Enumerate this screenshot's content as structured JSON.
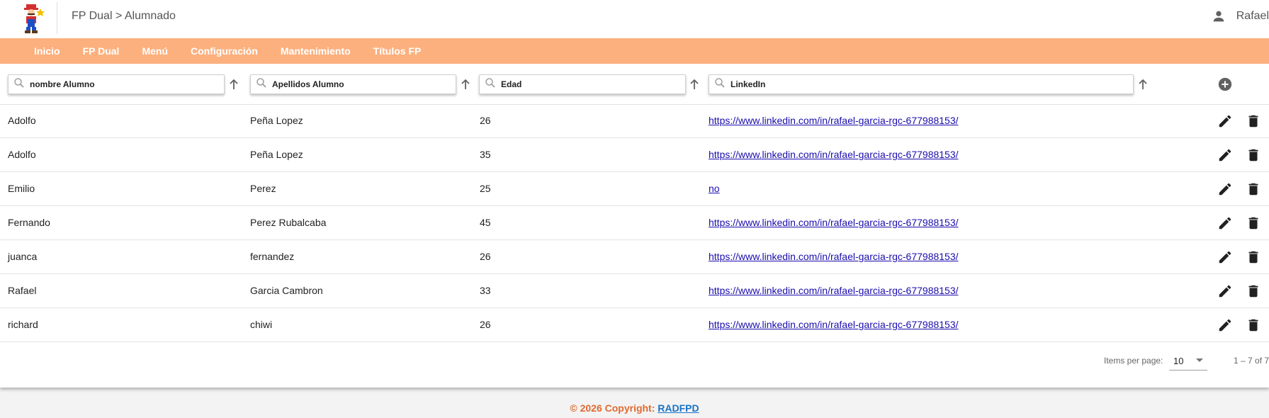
{
  "header": {
    "breadcrumb": "FP Dual > Alumnado",
    "user_name": "Rafael"
  },
  "nav": {
    "items": [
      "Inicio",
      "FP Dual",
      "Menú",
      "Configuración",
      "Mantenimiento",
      "Títulos FP"
    ]
  },
  "filters": {
    "nombre": "nombre Alumno",
    "apellidos": "Apellidos Alumno",
    "edad": "Edad",
    "linkedin": "LinkedIn"
  },
  "table": {
    "rows": [
      {
        "nombre": "Adolfo",
        "apellidos": "Peña Lopez",
        "edad": "26",
        "linkedin": "https://www.linkedin.com/in/rafael-garcia-rgc-677988153/"
      },
      {
        "nombre": "Adolfo",
        "apellidos": "Peña Lopez",
        "edad": "35",
        "linkedin": "https://www.linkedin.com/in/rafael-garcia-rgc-677988153/"
      },
      {
        "nombre": "Emilio",
        "apellidos": "Perez",
        "edad": "25",
        "linkedin": "no"
      },
      {
        "nombre": "Fernando",
        "apellidos": "Perez Rubalcaba",
        "edad": "45",
        "linkedin": "https://www.linkedin.com/in/rafael-garcia-rgc-677988153/"
      },
      {
        "nombre": "juanca",
        "apellidos": "fernandez",
        "edad": "26",
        "linkedin": "https://www.linkedin.com/in/rafael-garcia-rgc-677988153/"
      },
      {
        "nombre": "Rafael",
        "apellidos": "Garcia Cambron",
        "edad": "33",
        "linkedin": "https://www.linkedin.com/in/rafael-garcia-rgc-677988153/"
      },
      {
        "nombre": "richard",
        "apellidos": "chiwi",
        "edad": "26",
        "linkedin": "https://www.linkedin.com/in/rafael-garcia-rgc-677988153/"
      }
    ]
  },
  "paginator": {
    "items_per_page_label": "Items per page:",
    "page_size": "10",
    "range_label": "1 – 7 of 7"
  },
  "footer": {
    "copyright": "© 2026 Copyright:",
    "link": "RADFPD"
  },
  "colors": {
    "nav_background": "#fcb07e",
    "link": "#1a0dab",
    "footer_text": "#e06a30"
  },
  "icons": {
    "user": "person-icon",
    "search": "search-icon",
    "sort": "arrow-up-icon",
    "add": "add-circle-icon",
    "edit": "pencil-icon",
    "delete": "trash-icon"
  }
}
